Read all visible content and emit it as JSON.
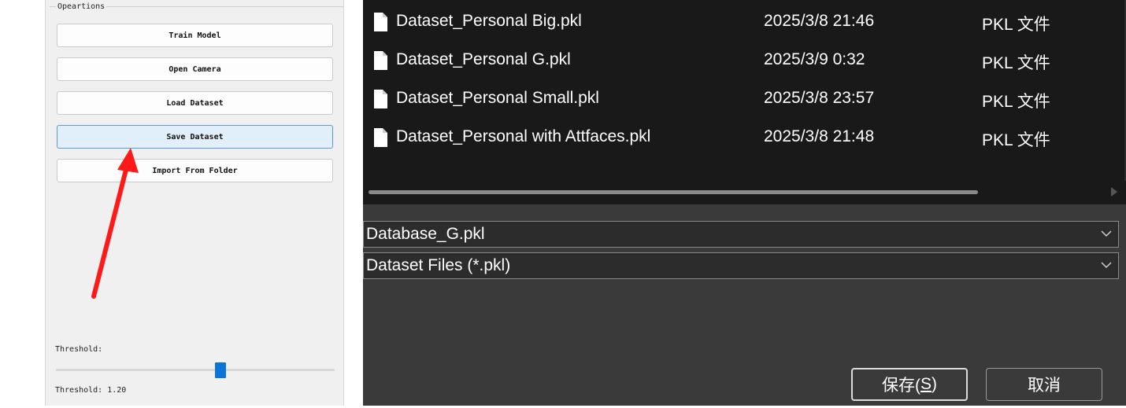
{
  "left_panel": {
    "group_title": "Opeartions",
    "buttons": {
      "train": "Train Model",
      "camera": "Open Camera",
      "load": "Load Dataset",
      "save": "Save Dataset",
      "import": "Import From Folder"
    },
    "threshold_label": "Threshold:",
    "threshold_value_text": "Threshold: 1.20",
    "slider_level": 0.59
  },
  "annotation": {
    "arrow_color": "#ff1a1a"
  },
  "dialog": {
    "files": [
      {
        "name": "Dataset_Personal Big.pkl",
        "date": "2025/3/8 21:46",
        "type": "PKL 文件"
      },
      {
        "name": "Dataset_Personal G.pkl",
        "date": "2025/3/9 0:32",
        "type": "PKL 文件"
      },
      {
        "name": "Dataset_Personal Small.pkl",
        "date": "2025/3/8 23:57",
        "type": "PKL 文件"
      },
      {
        "name": "Dataset_Personal with Attfaces.pkl",
        "date": "2025/3/8 21:48",
        "type": "PKL 文件"
      }
    ],
    "filename_value": "Database_G.pkl",
    "filetype_value": "Dataset Files (*.pkl)",
    "save_label_main": "保存(",
    "save_label_key": "S",
    "save_label_end": ")",
    "cancel_label": "取消"
  },
  "colors": {
    "accent_blue": "#0a74d8",
    "dialog_bg": "#3a3a3a",
    "list_bg": "#191919"
  }
}
